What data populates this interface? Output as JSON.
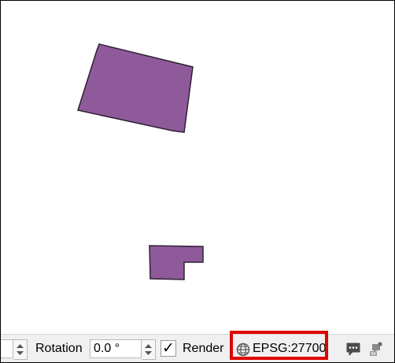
{
  "statusbar": {
    "rotation_label": "Rotation",
    "rotation_value": "0.0 °",
    "render_checked_glyph": "✓",
    "render_label": "Render",
    "crs_label": "EPSG:27700",
    "crs_icon": "globe-icon",
    "messages_icon": "speech-bubble-icon",
    "log_icon": "log-messages-icon"
  },
  "map": {
    "feature_fill": "#8f5a9a",
    "feature_stroke": "#2f2136"
  },
  "colors": {
    "highlight": "#e00000",
    "statusbar_bg": "#f0f0f0"
  }
}
